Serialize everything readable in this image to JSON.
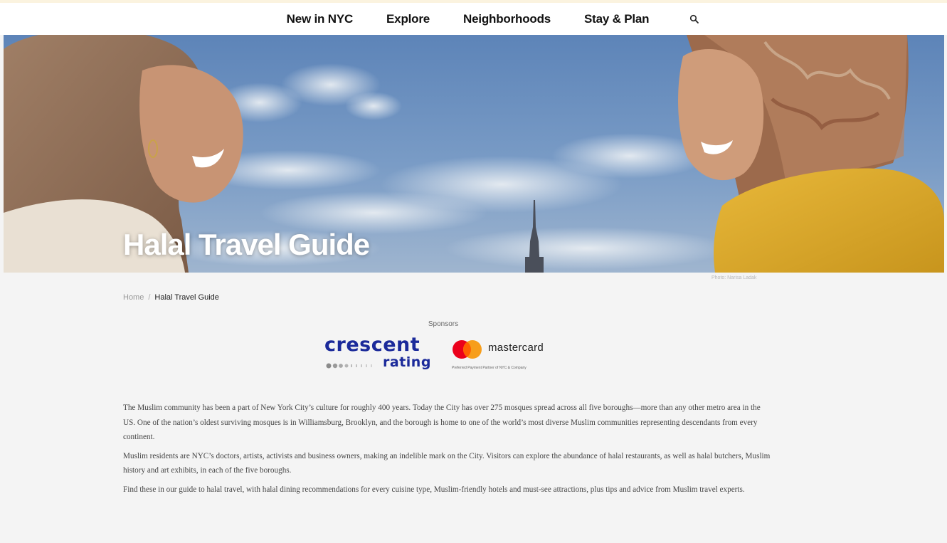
{
  "nav": {
    "items": [
      "New in NYC",
      "Explore",
      "Neighborhoods",
      "Stay & Plan"
    ],
    "search_icon": "search-icon"
  },
  "hero": {
    "title": "Halal Travel Guide",
    "photo_credit": "Photo: Narisa Ladak"
  },
  "breadcrumb": {
    "home": "Home",
    "separator": "/",
    "current": "Halal Travel Guide"
  },
  "sponsors": {
    "label": "Sponsors",
    "crescent_word": "crescent",
    "rating_word": "rating",
    "mastercard_word": "mastercard",
    "mastercard_tagline": "Preferred Payment Partner of NYC & Company"
  },
  "body": {
    "paragraphs": [
      "The Muslim community has been a part of New York City’s culture for roughly 400 years. Today the City has over 275 mosques spread across all five boroughs—more than any other metro area in the US. One of the nation’s oldest surviving mosques is in Williamsburg, Brooklyn, and the borough is home to one of the world’s most diverse Muslim communities representing descendants from every continent.",
      "Muslim residents are NYC’s doctors, artists, activists and business owners, making an indelible mark on the City. Visitors can explore the abundance of halal restaurants, as well as halal butchers, Muslim history and art exhibits, in each of the five boroughs.",
      "Find these in our guide to halal travel, with halal dining recommendations for every cuisine type, Muslim-friendly hotels and must-see attractions, plus tips and advice from Muslim travel experts."
    ]
  },
  "colors": {
    "crescent_blue": "#1b2a9a",
    "mastercard_red": "#eb001b",
    "mastercard_orange": "#f79e1b",
    "sky_blue": "#6e92bf"
  }
}
